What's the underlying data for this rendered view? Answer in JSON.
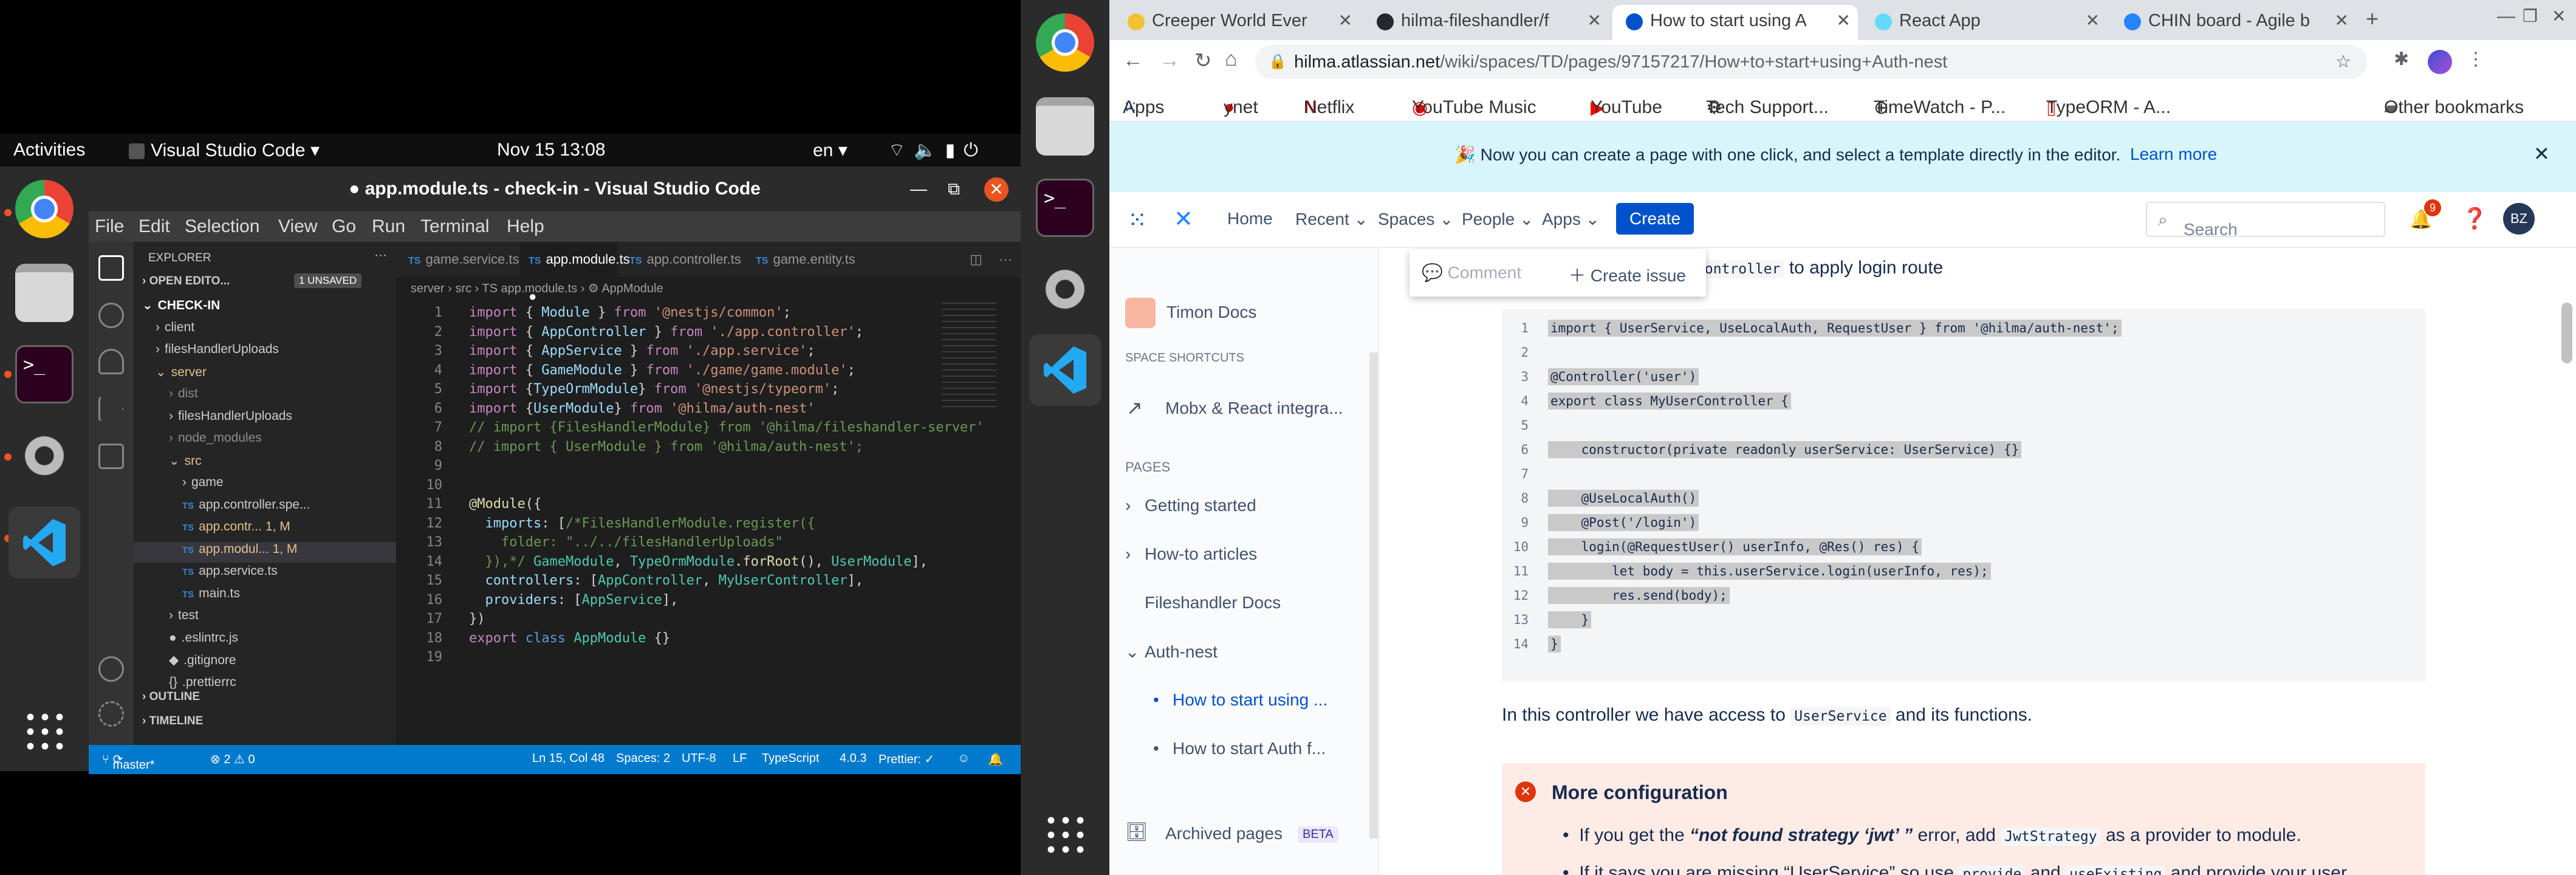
{
  "gnome": {
    "activities": "Activities",
    "app_name": "Visual Studio Code ▾",
    "clock": "Nov 15  13:08",
    "lang": "en ▾"
  },
  "vscode": {
    "window_title": "● app.module.ts - check-in - Visual Studio Code",
    "menu": [
      "File",
      "Edit",
      "Selection",
      "View",
      "Go",
      "Run",
      "Terminal",
      "Help"
    ],
    "explorer_title": "EXPLORER",
    "open_editors": "OPEN EDITO...",
    "unsaved_badge": "1 UNSAVED",
    "tree": [
      {
        "label": "CHECK-IN",
        "indent": 0,
        "caret": "⌄",
        "color": "#ffffff",
        "bold": true
      },
      {
        "label": "client",
        "indent": 1,
        "caret": "›",
        "color": "#cccccc"
      },
      {
        "label": "filesHandlerUploads",
        "indent": 1,
        "caret": "›",
        "color": "#cccccc"
      },
      {
        "label": "server",
        "indent": 1,
        "caret": "⌄",
        "color": "#e2c08d"
      },
      {
        "label": "dist",
        "indent": 2,
        "caret": "›",
        "color": "#8c8c8c"
      },
      {
        "label": "filesHandlerUploads",
        "indent": 2,
        "caret": "›",
        "color": "#cccccc"
      },
      {
        "label": "node_modules",
        "indent": 2,
        "caret": "›",
        "color": "#8c8c8c"
      },
      {
        "label": "src",
        "indent": 2,
        "caret": "⌄",
        "color": "#e2c08d"
      },
      {
        "label": "game",
        "indent": 3,
        "caret": "›",
        "color": "#cccccc"
      },
      {
        "label": "app.controller.spe...",
        "indent": 3,
        "caret": "TS",
        "color": "#cccccc"
      },
      {
        "label": "app.contr...  1, M",
        "indent": 3,
        "caret": "TS",
        "color": "#e2c08d"
      },
      {
        "label": "app.modul...  1, M",
        "indent": 3,
        "caret": "TS",
        "color": "#e2c08d",
        "selected": true
      },
      {
        "label": "app.service.ts",
        "indent": 3,
        "caret": "TS",
        "color": "#cccccc"
      },
      {
        "label": "main.ts",
        "indent": 3,
        "caret": "TS",
        "color": "#cccccc"
      },
      {
        "label": "test",
        "indent": 2,
        "caret": "›",
        "color": "#cccccc"
      },
      {
        "label": ".eslintrc.js",
        "indent": 2,
        "caret": "●",
        "color": "#cccccc"
      },
      {
        "label": ".gitignore",
        "indent": 2,
        "caret": "◆",
        "color": "#cccccc"
      },
      {
        "label": ".prettierrc",
        "indent": 2,
        "caret": "{}",
        "color": "#cccccc"
      }
    ],
    "outline": "OUTLINE",
    "timeline": "TIMELINE",
    "tabs": [
      "game.service.ts",
      "app.module.ts",
      "app.controller.ts",
      "game.entity.ts"
    ],
    "active_tab": 1,
    "breadcrumb": "server  ›  src  ›  TS app.module.ts  ›  ⚙ AppModule",
    "code_lines": [
      "<span class='k2'>import</span> { <span class='v'>Module</span> } <span class='k2'>from</span> <span class='s'>'@nestjs/common'</span>;",
      "<span class='k2'>import</span> { <span class='v'>AppController</span> } <span class='k2'>from</span> <span class='s'>'./app.controller'</span>;",
      "<span class='k2'>import</span> { <span class='v'>AppService</span> } <span class='k2'>from</span> <span class='s'>'./app.service'</span>;",
      "<span class='k2'>import</span> { <span class='v'>GameModule</span> } <span class='k2'>from</span> <span class='s'>'./game/game.module'</span>;",
      "<span class='k2'>import</span> {<span class='v'>TypeOrmModule</span>} <span class='k2'>from</span> <span class='s'>'@nestjs/typeorm'</span>;",
      "<span class='k2'>import</span> {<span class='v'>UserModule</span>} <span class='k2'>from</span> <span class='s'>'@hilma/auth-nest'</span>",
      "<span class='c'>// import {FilesHandlerModule} from '@hilma/fileshandler-server'</span>",
      "<span class='c'>// import { UserModule } from '@hilma/auth-nest';</span>",
      "",
      "",
      "<span class='f'>@Module</span>({",
      "  <span class='v'>imports</span>: [<span class='c'>/*FilesHandlerModule.register({</span>",
      "<span class='c'>    folder: \"../../filesHandlerUploads\"</span>",
      "<span class='c'>  }),*/</span> <span class='t'>GameModule</span>, <span class='t'>TypeOrmModule</span>.<span class='f'>forRoot</span>(), <span class='t'>UserModule</span>],",
      "  <span class='v'>controllers</span>: [<span class='t'>AppController</span>, <span class='t'>MyUserController</span>],",
      "  <span class='v'>providers</span>: [<span class='t'>AppService</span>],",
      "})",
      "<span class='k2'>export</span> <span class='k'>class</span> <span class='t'>AppModule</span> {}",
      ""
    ],
    "status": {
      "branch": "master*",
      "errors": "⊗ 2 ⚠ 0",
      "position": "Ln 15, Col 48",
      "spaces": "Spaces: 2",
      "encoding": "UTF-8",
      "eol": "LF",
      "language": "TypeScript",
      "version": "4.0.3",
      "prettier": "Prettier: ✓"
    }
  },
  "chrome": {
    "tabs": [
      {
        "title": "Creeper World Ever",
        "icon_color": "#f2c230"
      },
      {
        "title": "hilma-fileshandler/f",
        "icon_color": "#24292e"
      },
      {
        "title": "How to start using A",
        "icon_color": "#0052cc"
      },
      {
        "title": "React App",
        "icon_color": "#61dafb"
      },
      {
        "title": "CHIN board - Agile b",
        "icon_color": "#2684ff"
      }
    ],
    "active_tab": 2,
    "url_host": "hilma.atlassian.net",
    "url_path": "/wiki/spaces/TD/pages/97157217/How+to+start+using+Auth-nest",
    "bookmarks": [
      "Apps",
      "ynet",
      "Netflix",
      "YouTube Music",
      "YouTube",
      "Tech Support...",
      "TimeWatch - P...",
      "TypeORM - A..."
    ],
    "other_bookmarks": "Other bookmarks",
    "window_controls": [
      "—",
      "❐",
      "✕"
    ]
  },
  "confluence": {
    "banner_text": "🎉 Now you can create a page with one click, and select a template directly in the editor.",
    "banner_link": "Learn more",
    "nav": [
      "Home",
      "Recent ⌄",
      "Spaces ⌄",
      "People ⌄",
      "Apps ⌄"
    ],
    "create_label": "Create",
    "search_placeholder": "Search",
    "notif_count": "9",
    "avatar_initials": "BZ",
    "space_name": "Timon Docs",
    "space_shortcuts": "SPACE SHORTCUTS",
    "shortcut": "Mobx & React integra...",
    "pages_heading": "PAGES",
    "pages": [
      {
        "label": "Getting started",
        "caret": "›",
        "indent": 0
      },
      {
        "label": "How-to articles",
        "caret": "›",
        "indent": 0
      },
      {
        "label": "Fileshandler Docs",
        "caret": "",
        "indent": 0
      },
      {
        "label": "Auth-nest",
        "caret": "⌄",
        "indent": 0
      },
      {
        "label": "How to start using ...",
        "caret": "•",
        "indent": 1,
        "active": true
      },
      {
        "label": "How to start Auth f...",
        "caret": "•",
        "indent": 1
      }
    ],
    "archived": "Archived pages",
    "beta": "BETA",
    "toolbar_comment": "Comment",
    "toolbar_issue": "Create issue",
    "intro_code": "Controller",
    "intro_text": "to apply login route",
    "code_block": [
      "import { UserService, UseLocalAuth, RequestUser } from '@hilma/auth-nest';",
      "",
      "@Controller('user')",
      "export class MyUserController {",
      "",
      "    constructor(private readonly userService: UserService) {}",
      "",
      "    @UseLocalAuth()",
      "    @Post('/login')",
      "    login(@RequestUser() userInfo, @Res() res) {",
      "        let body = this.userService.login(userInfo, res);",
      "        res.send(body);",
      "    }",
      "}"
    ],
    "para_before": "In this controller we have access to",
    "para_code": "UserService",
    "para_after": "and its functions.",
    "warn_title": "More configuration",
    "warn_item1_a": "If you get the",
    "warn_item1_b": "“not found strategy ‘jwt’ ”",
    "warn_item1_c": "error, add",
    "warn_item1_code": "JwtStrategy",
    "warn_item1_d": "as a provider to module.",
    "warn_item2_a": "If it says you are missing “UserService” so use",
    "warn_item2_code1": "provide",
    "warn_item2_and": "and",
    "warn_item2_code2": "useExisting",
    "warn_item2_b": "and provide your user"
  }
}
